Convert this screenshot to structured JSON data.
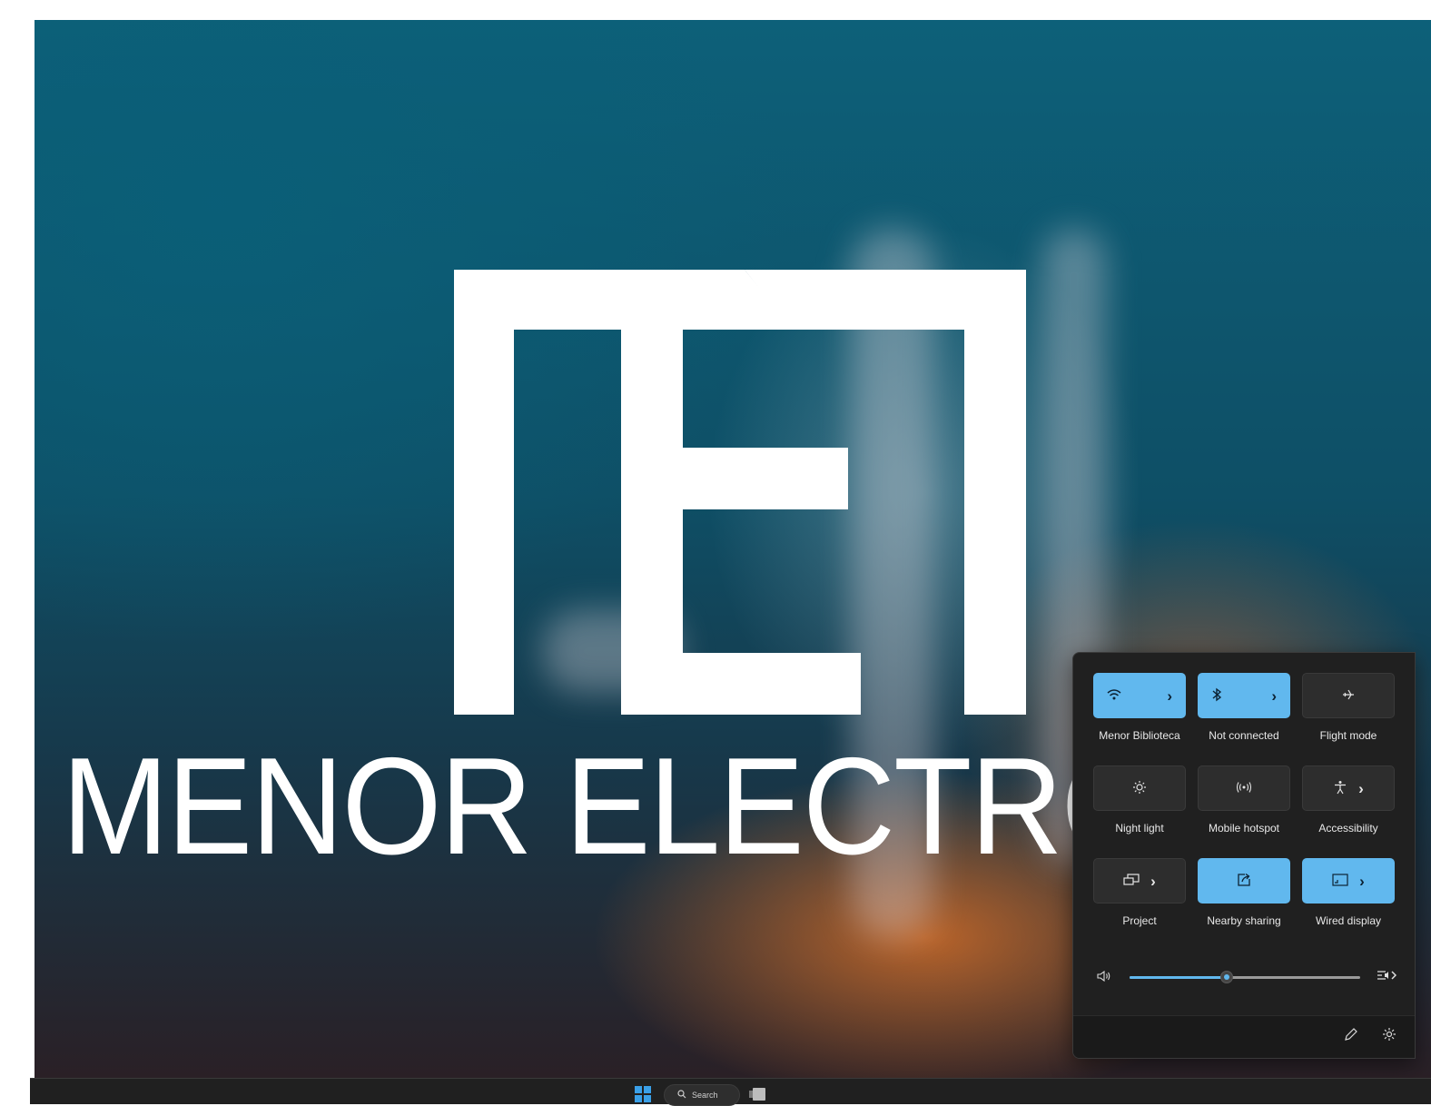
{
  "desktop": {
    "wallpaper_text": "MENOR ELECTRO"
  },
  "quick_settings": {
    "tiles": [
      {
        "label": "Menor Biblioteca",
        "icon": "wifi-icon",
        "active": true,
        "has_chevron": true
      },
      {
        "label": "Not connected",
        "icon": "bluetooth-icon",
        "active": true,
        "has_chevron": true
      },
      {
        "label": "Flight mode",
        "icon": "airplane-icon",
        "active": false,
        "has_chevron": false
      },
      {
        "label": "Night light",
        "icon": "brightness-icon",
        "active": false,
        "has_chevron": false
      },
      {
        "label": "Mobile hotspot",
        "icon": "hotspot-icon",
        "active": false,
        "has_chevron": false
      },
      {
        "label": "Accessibility",
        "icon": "accessibility-icon",
        "active": false,
        "has_chevron": true
      },
      {
        "label": "Project",
        "icon": "project-icon",
        "active": false,
        "has_chevron": true
      },
      {
        "label": "Nearby sharing",
        "icon": "share-icon",
        "active": true,
        "has_chevron": false
      },
      {
        "label": "Wired display",
        "icon": "cast-icon",
        "active": true,
        "has_chevron": true
      }
    ],
    "volume": {
      "level": 0.42,
      "icon": "speaker-icon",
      "output_icon": "audio-output-icon"
    },
    "footer": {
      "edit_icon": "pencil-icon",
      "settings_icon": "gear-icon"
    },
    "accent_color": "#61b8ee"
  },
  "taskbar": {
    "search_label": "Search",
    "start_icon": "windows-logo-icon",
    "taskview_icon": "task-view-icon"
  }
}
